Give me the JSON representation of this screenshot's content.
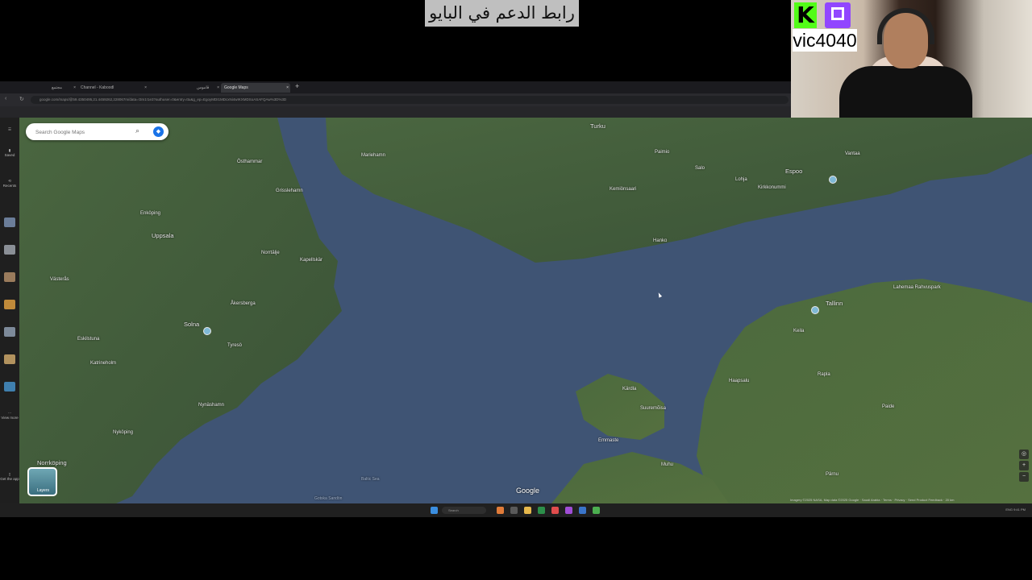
{
  "overlay": {
    "caption": "رابط الدعم في البايو",
    "streamer_name": "vic4040",
    "kick_letter": "K"
  },
  "browser": {
    "tabs": [
      {
        "label": "مجتمع"
      },
      {
        "label": "Channel - Kaboodl"
      },
      {
        "label": ""
      },
      {
        "label": "قاموس"
      },
      {
        "label": "Google Maps",
        "active": true
      }
    ],
    "new_tab": "+",
    "url": "google.com/maps/@59.4350495,21.4459262,228067m/data=!3m1!1e3?authuser=0&entry=ttu&g_ep=EgoyMDI1MDcxNi4wIKXMDSoASAFQAw%3D%3D"
  },
  "sidebar": {
    "items": [
      {
        "label": "",
        "icon": "menu-icon"
      },
      {
        "label": "Saved",
        "icon": "bookmark-icon"
      },
      {
        "label": "Recents",
        "icon": "history-icon"
      },
      {
        "label": "",
        "icon": "recent-thumb"
      },
      {
        "label": "",
        "icon": "recent-thumb"
      },
      {
        "label": "",
        "icon": "recent-thumb"
      },
      {
        "label": "",
        "icon": "recent-thumb"
      },
      {
        "label": "",
        "icon": "recent-thumb"
      },
      {
        "label": "",
        "icon": "recent-thumb"
      },
      {
        "label": "",
        "icon": "recent-thumb"
      },
      {
        "label": "View more",
        "icon": "more-icon"
      },
      {
        "label": "Get the app",
        "icon": "phone-icon"
      }
    ]
  },
  "map": {
    "search_placeholder": "Search Google Maps",
    "layers_label": "Layers",
    "watermark": "Google",
    "attribution": "Imagery ©2025 NASA, Map data ©2025 Google · Saudi Arabia · Terms · Privacy · Send Product Feedback · 20 km",
    "places": [
      {
        "name": "Turku",
        "size": "big"
      },
      {
        "name": "Espoo",
        "size": "big"
      },
      {
        "name": "Vantaa",
        "size": "normal"
      },
      {
        "name": "Uppsala",
        "size": "big"
      },
      {
        "name": "Västerås",
        "size": "normal"
      },
      {
        "name": "Solna",
        "size": "big"
      },
      {
        "name": "Norrtälje",
        "size": "normal"
      },
      {
        "name": "Kapellskär",
        "size": "normal"
      },
      {
        "name": "Åkersberga",
        "size": "normal"
      },
      {
        "name": "Tyresö",
        "size": "normal"
      },
      {
        "name": "Nynäshamn",
        "size": "normal"
      },
      {
        "name": "Nyköping",
        "size": "normal"
      },
      {
        "name": "Norrköping",
        "size": "big"
      },
      {
        "name": "Eskilstuna",
        "size": "normal"
      },
      {
        "name": "Katrineholm",
        "size": "normal"
      },
      {
        "name": "Enköping",
        "size": "normal"
      },
      {
        "name": "Östhammar",
        "size": "normal"
      },
      {
        "name": "Grisslehamn",
        "size": "normal"
      },
      {
        "name": "Hanko",
        "size": "normal"
      },
      {
        "name": "Kemiönsaari",
        "size": "normal"
      },
      {
        "name": "Paimio",
        "size": "normal"
      },
      {
        "name": "Salo",
        "size": "normal"
      },
      {
        "name": "Lohja",
        "size": "normal"
      },
      {
        "name": "Kirkkonummi",
        "size": "normal"
      },
      {
        "name": "Tallinn",
        "size": "normal"
      },
      {
        "name": "Kärdla",
        "size": "normal"
      },
      {
        "name": "Haapsalu",
        "size": "normal"
      },
      {
        "name": "Suuremõisa",
        "size": "normal"
      },
      {
        "name": "Emmaste",
        "size": "normal"
      },
      {
        "name": "Muhu",
        "size": "normal"
      },
      {
        "name": "Rapla",
        "size": "normal"
      },
      {
        "name": "Paide",
        "size": "normal"
      },
      {
        "name": "Pärnu",
        "size": "normal"
      },
      {
        "name": "Keila",
        "size": "normal"
      },
      {
        "name": "Lahemaa Rahvuspark",
        "size": "normal"
      },
      {
        "name": "Mariehamn",
        "size": "normal"
      },
      {
        "name": "Baltic Sea",
        "size": "sea"
      },
      {
        "name": "Gotska Sandön",
        "size": "sea"
      }
    ]
  },
  "taskbar": {
    "search_placeholder": "Search",
    "tray_text": "ENG  9:41 PM"
  },
  "colors": {
    "kick_green": "#53fc18",
    "twitch_purple": "#9146ff",
    "sea": "#3f5474",
    "land": "#3f5a3a",
    "maps_blue": "#1a73e8"
  }
}
